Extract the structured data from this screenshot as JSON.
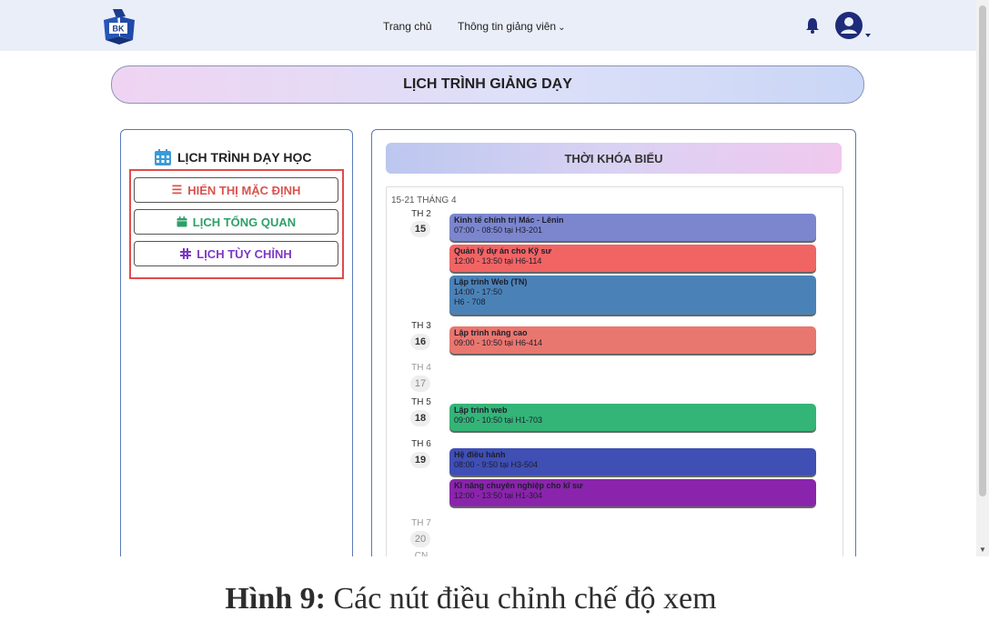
{
  "nav": {
    "home": "Trang chủ",
    "info": "Thông tin giảng viên",
    "logo_text": "BK"
  },
  "page_title": "LỊCH TRÌNH GIẢNG DẠY",
  "left_panel": {
    "title": "LỊCH TRÌNH DẠY HỌC",
    "buttons": [
      {
        "label": "HIỂN THỊ MẶC ĐỊNH",
        "icon": "list-icon",
        "color": "#d9534f"
      },
      {
        "label": "LỊCH TỔNG QUAN",
        "icon": "calendar-icon",
        "color": "#2e9f68"
      },
      {
        "label": "LỊCH TÙY CHỈNH",
        "icon": "grid-settings-icon",
        "color": "#7d39c2"
      }
    ]
  },
  "schedule": {
    "header": "THỜI KHÓA BIỂU",
    "week": "15-21 THÁNG 4",
    "days": [
      {
        "name": "TH 2",
        "num": "15",
        "events": [
          {
            "title": "Kinh tế chính trị Mác - Lênin",
            "line1": "07:00 - 08:50 tại H3-201",
            "color": "#7b86cf"
          },
          {
            "title": "Quản lý dự án cho Kỹ sư",
            "line1": "12:00 - 13:50 tại H6-114",
            "color": "#f06464"
          },
          {
            "title": "Lập trình Web (TN)",
            "line1": "14:00 - 17:50",
            "line2": "H6 - 708",
            "color": "#4a82b8"
          }
        ]
      },
      {
        "name": "TH 3",
        "num": "16",
        "events": [
          {
            "title": "Lập trình nâng cao",
            "line1": "09:00 - 10:50 tại H6-414",
            "color": "#e8776f"
          }
        ]
      },
      {
        "name": "TH 4",
        "num": "17",
        "events": []
      },
      {
        "name": "TH 5",
        "num": "18",
        "events": [
          {
            "title": "Lập trình web",
            "line1": "09:00 - 10:50 tại H1-703",
            "color": "#33b577"
          }
        ]
      },
      {
        "name": "TH 6",
        "num": "19",
        "events": [
          {
            "title": "Hệ điều hành",
            "line1": "08:00 - 9:50 tại H3-504",
            "color": "#3f4fb4"
          },
          {
            "title": "Kĩ năng chuyên nghiệp cho kĩ sư",
            "line1": "12:00 - 13:50 tại H1-304",
            "color": "#8b24ac"
          }
        ]
      },
      {
        "name": "TH 7",
        "num": "20",
        "events": []
      },
      {
        "name": "CN",
        "num": "",
        "events": []
      }
    ]
  },
  "caption": {
    "bold": "Hình 9:",
    "text": " Các nút điều chỉnh chế độ xem"
  }
}
